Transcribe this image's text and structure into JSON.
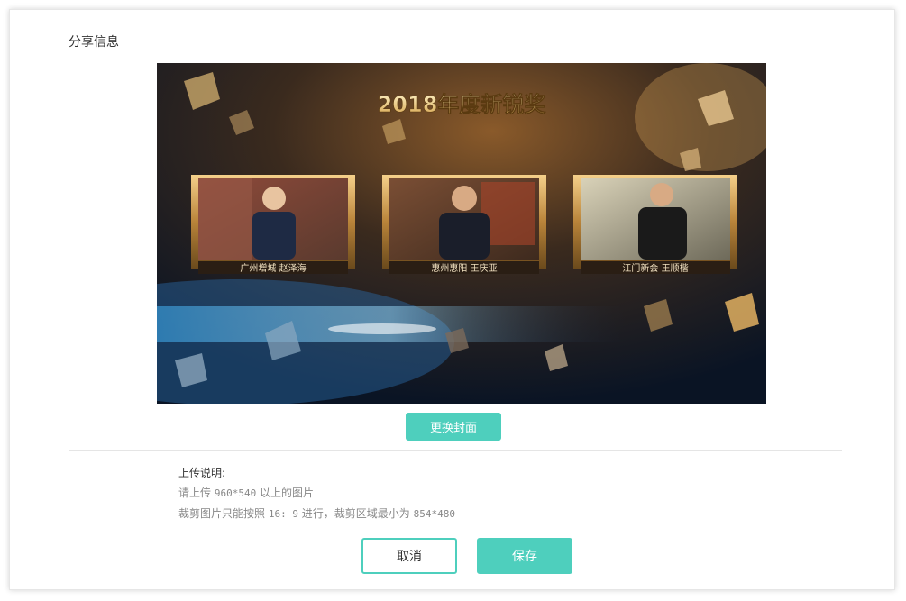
{
  "dialog": {
    "title": "分享信息"
  },
  "cover": {
    "image_description": "award ceremony cover image with three framed portraits",
    "headline": "2018年度新锐奖",
    "portraits": [
      {
        "caption": "广州增城 赵泽海"
      },
      {
        "caption": "惠州惠阳 王庆亚"
      },
      {
        "caption": "江门新会 王顺楷"
      }
    ]
  },
  "actions": {
    "change_cover_label": "更换封面",
    "cancel_label": "取消",
    "save_label": "保存"
  },
  "upload_notes": {
    "title": "上传说明:",
    "line1_prefix": "请上传 ",
    "line1_size": "960*540",
    "line1_suffix": " 以上的图片",
    "line2_prefix": "裁剪图片只能按照 ",
    "line2_ratio": "16: 9",
    "line2_middle": " 进行，裁剪区域最小为 ",
    "line2_min": "854*480"
  },
  "colors": {
    "accent": "#4ecfbd",
    "text_primary": "#333333",
    "text_secondary": "#888888",
    "divider": "#e5e5e5"
  }
}
